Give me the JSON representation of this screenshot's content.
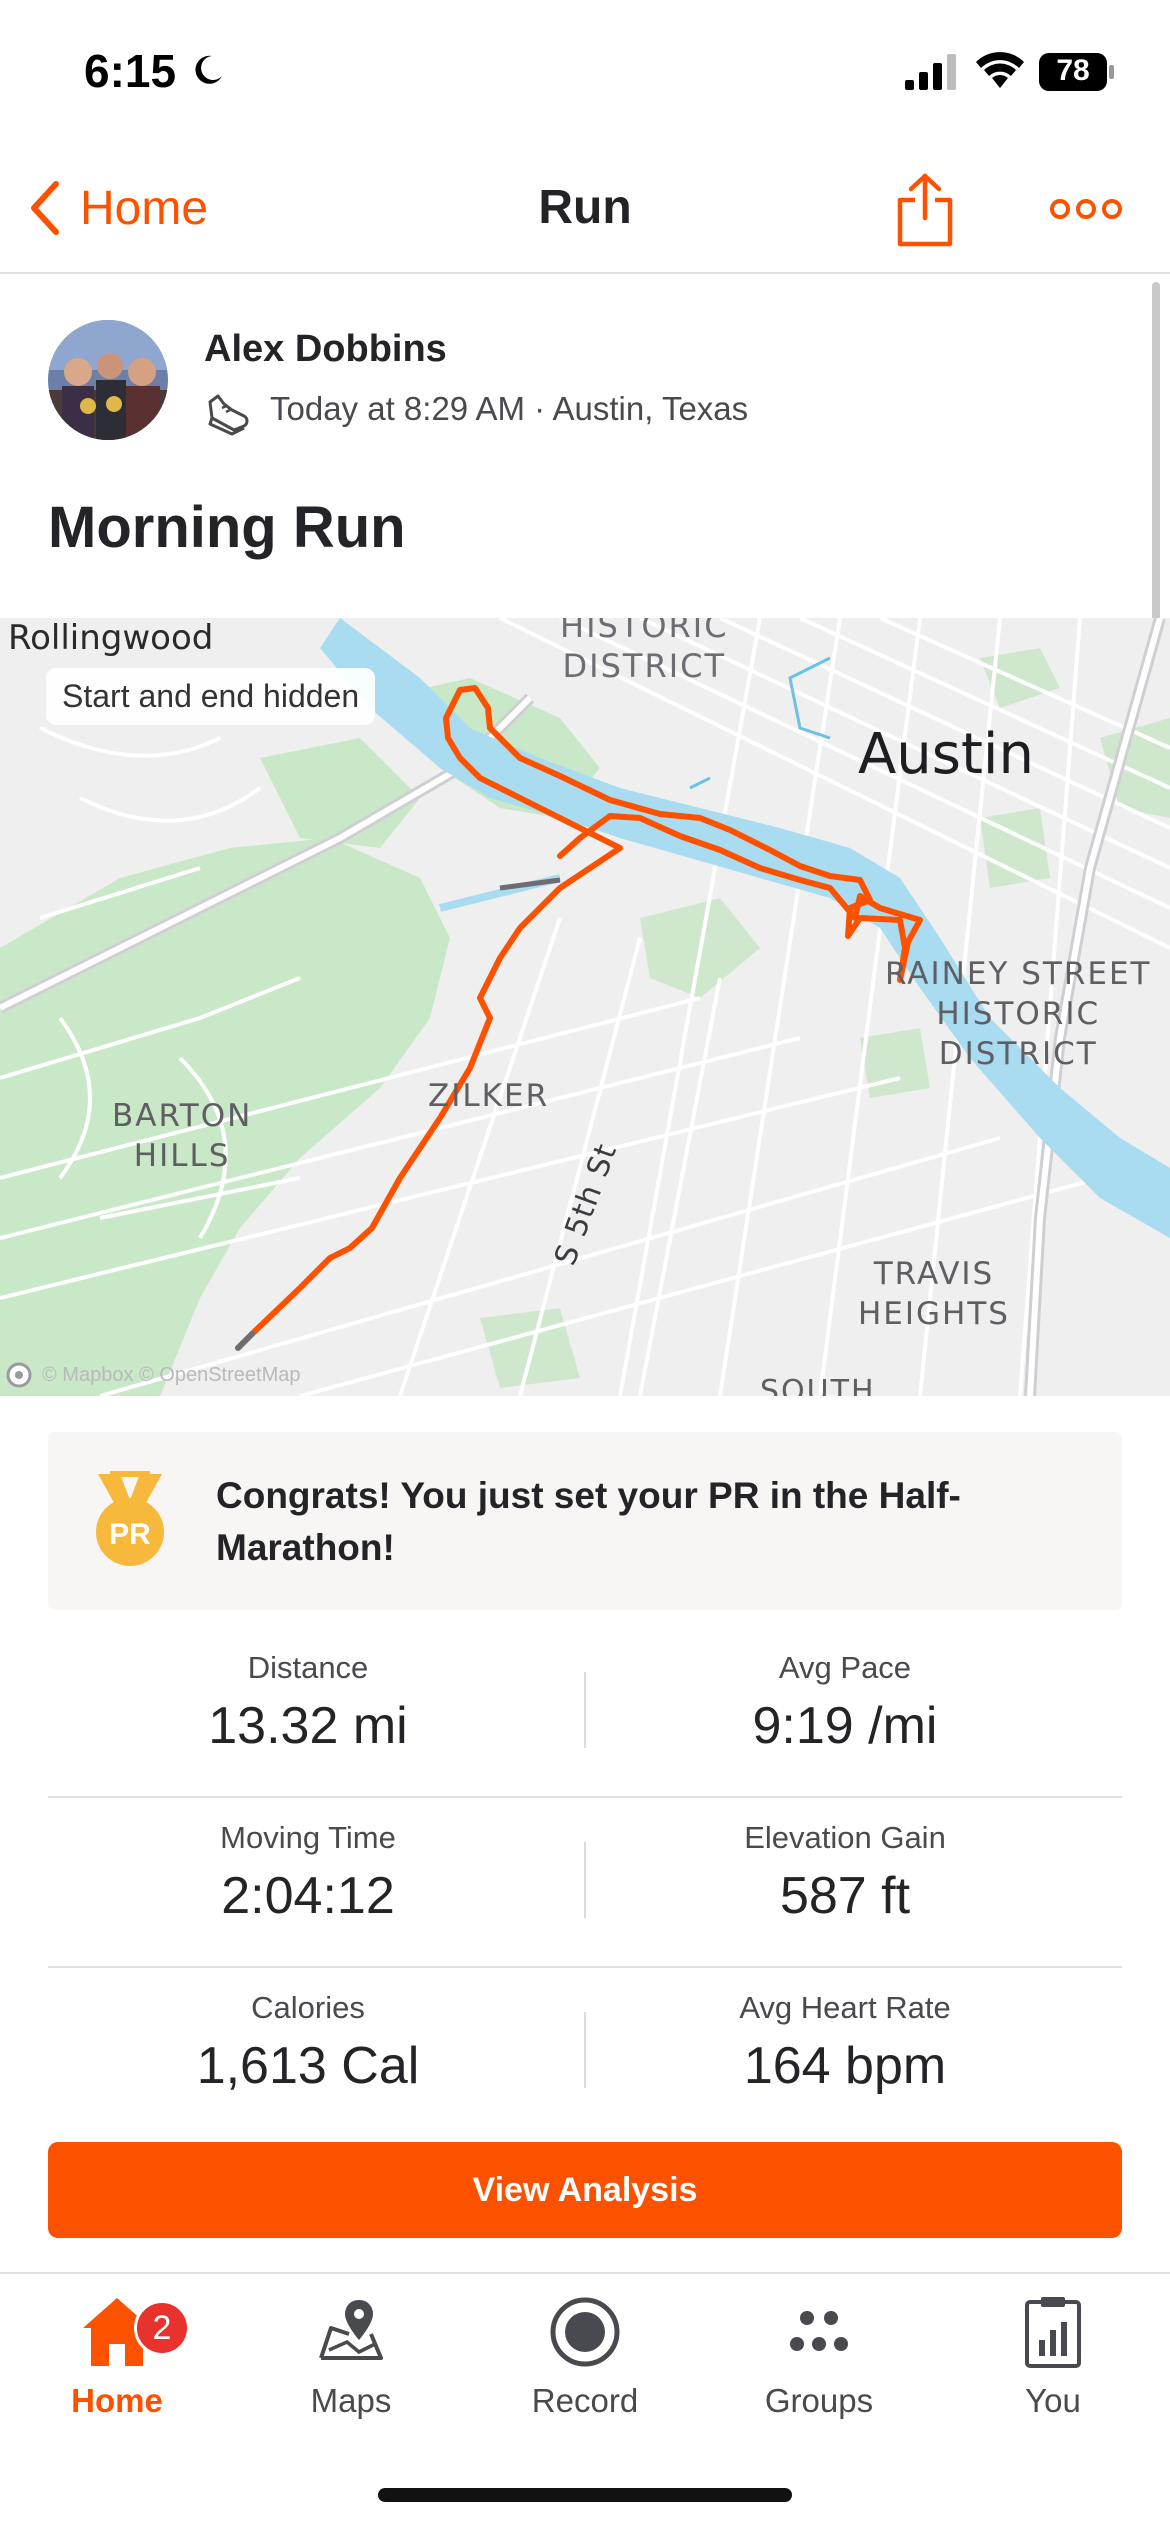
{
  "status_bar": {
    "time": "6:15",
    "battery": "78"
  },
  "navbar": {
    "back_label": "Home",
    "title": "Run"
  },
  "activity": {
    "athlete_name": "Alex Dobbins",
    "meta": "Today at 8:29 AM · Austin, Texas",
    "title": "Morning Run"
  },
  "map": {
    "privacy_badge": "Start and end hidden",
    "labels": {
      "rollingwood": "Rollingwood",
      "historic_district_1": "HISTORIC",
      "historic_district_2": "DISTRICT",
      "austin": "Austin",
      "rainey_1": "RAINEY STREET",
      "rainey_2": "HISTORIC",
      "rainey_3": "DISTRICT",
      "zilker": "ZILKER",
      "barton_1": "BARTON",
      "barton_2": "HILLS",
      "s5th": "S 5th St",
      "travis_1": "TRAVIS",
      "travis_2": "HEIGHTS",
      "south": "SOUTH"
    },
    "attribution": "© Mapbox  © OpenStreetMap",
    "route_color": "#fc5200"
  },
  "pr_banner": {
    "medal_text": "PR",
    "message": "Congrats! You just set your PR in the Half-Marathon!"
  },
  "stats": {
    "distance": {
      "label": "Distance",
      "value": "13.32 mi"
    },
    "avg_pace": {
      "label": "Avg Pace",
      "value": "9:19 /mi"
    },
    "moving_time": {
      "label": "Moving Time",
      "value": "2:04:12"
    },
    "elevation_gain": {
      "label": "Elevation Gain",
      "value": "587 ft"
    },
    "calories": {
      "label": "Calories",
      "value": "1,613 Cal"
    },
    "avg_heart_rate": {
      "label": "Avg Heart Rate",
      "value": "164 bpm"
    }
  },
  "view_analysis_label": "View Analysis",
  "tabbar": {
    "home": {
      "label": "Home",
      "badge": "2"
    },
    "maps": {
      "label": "Maps"
    },
    "record": {
      "label": "Record"
    },
    "groups": {
      "label": "Groups"
    },
    "you": {
      "label": "You"
    }
  },
  "colors": {
    "accent": "#fc5200",
    "badge": "#e8322d"
  }
}
